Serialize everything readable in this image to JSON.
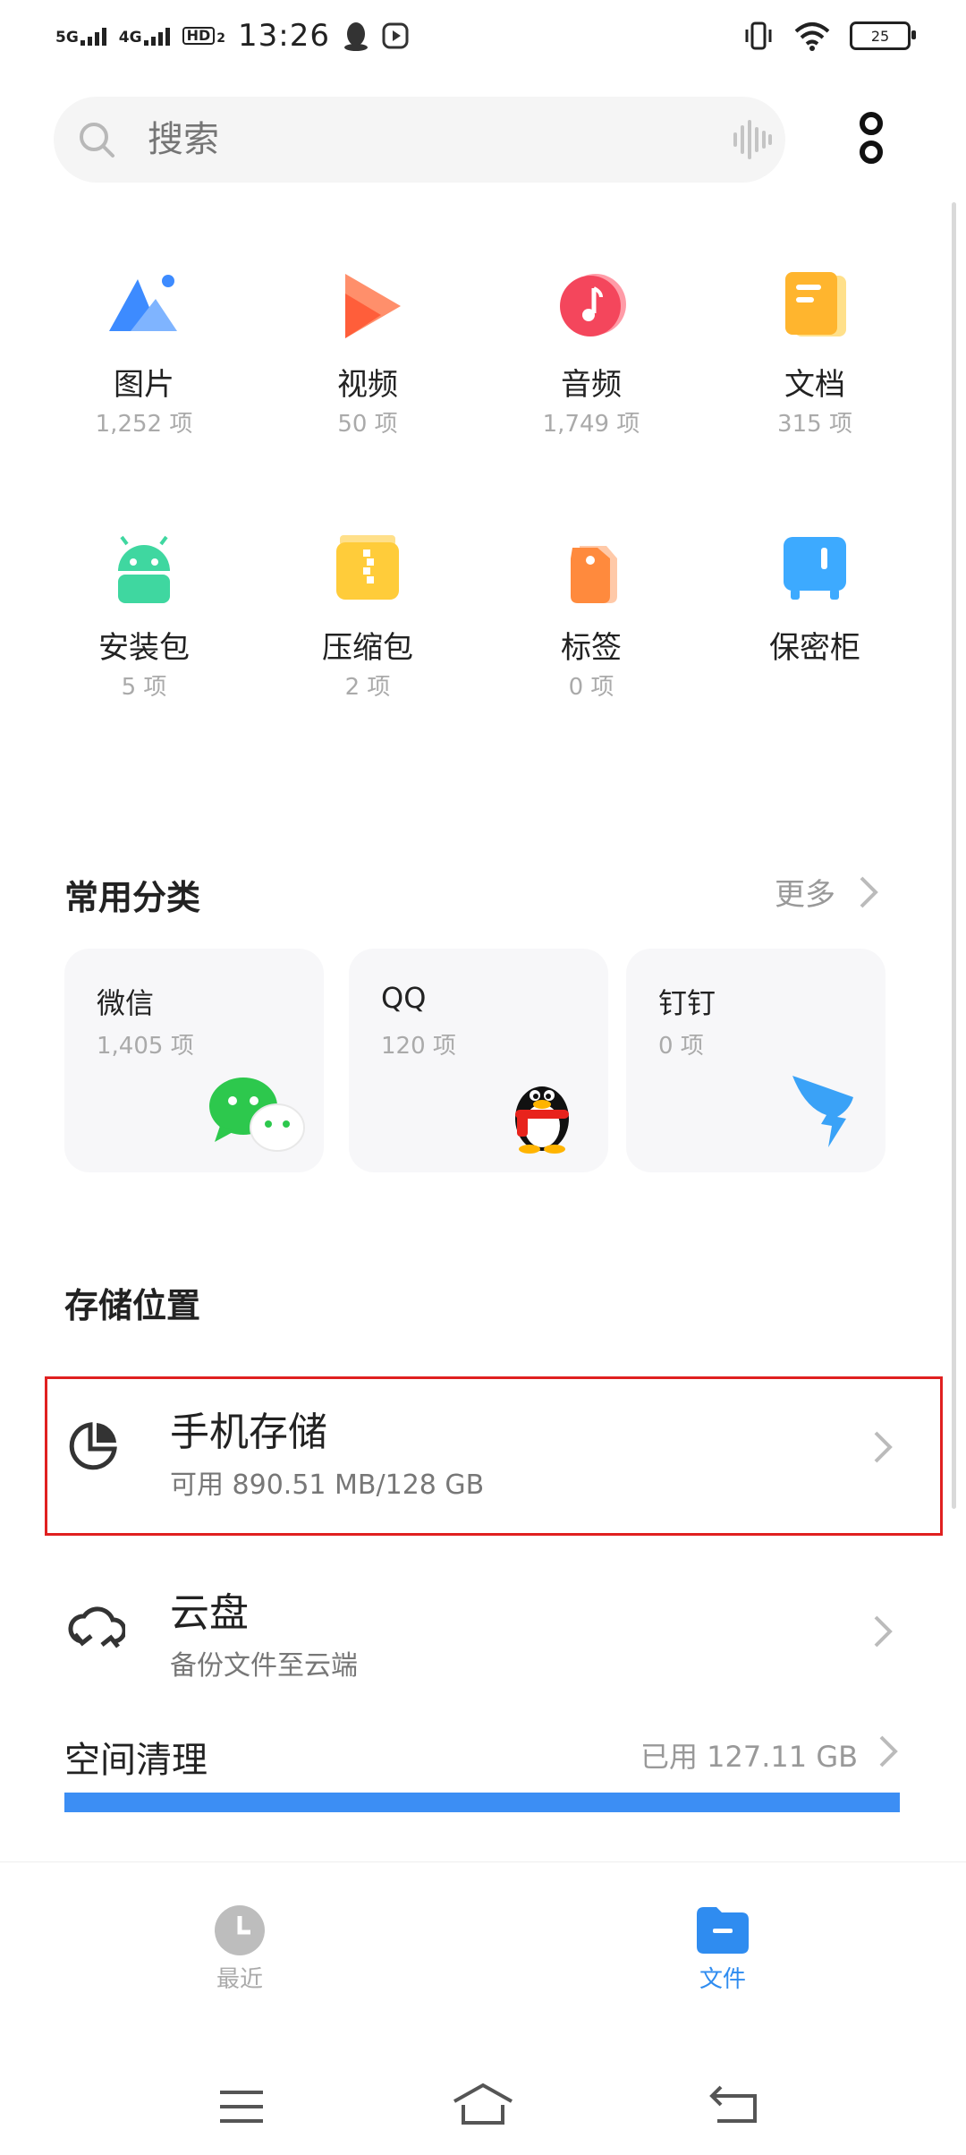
{
  "status_bar": {
    "network1": "5G",
    "network2": "4G",
    "hd": "HD",
    "hd_sub": "2",
    "time": "13:26",
    "battery": "25"
  },
  "search": {
    "placeholder": "搜索"
  },
  "categories": [
    {
      "name": "图片",
      "count": "1,252 项",
      "icon": "image-icon"
    },
    {
      "name": "视频",
      "count": "50 项",
      "icon": "video-icon"
    },
    {
      "name": "音频",
      "count": "1,749 项",
      "icon": "audio-icon"
    },
    {
      "name": "文档",
      "count": "315 项",
      "icon": "document-icon"
    },
    {
      "name": "安装包",
      "count": "5 项",
      "icon": "android-icon"
    },
    {
      "name": "压缩包",
      "count": "2 项",
      "icon": "archive-icon"
    },
    {
      "name": "标签",
      "count": "0 项",
      "icon": "tag-icon"
    },
    {
      "name": "保密柜",
      "count": "",
      "icon": "safe-icon"
    }
  ],
  "common": {
    "title": "常用分类",
    "more": "更多",
    "apps": [
      {
        "name": "微信",
        "count": "1,405 项",
        "icon": "wechat-icon"
      },
      {
        "name": "QQ",
        "count": "120 项",
        "icon": "qq-penguin-icon"
      },
      {
        "name": "钉钉",
        "count": "0 项",
        "icon": "dingtalk-icon"
      }
    ]
  },
  "storage": {
    "title": "存储位置",
    "phone": {
      "title": "手机存储",
      "sub": "可用 890.51 MB/128 GB"
    },
    "cloud": {
      "title": "云盘",
      "sub": "备份文件至云端"
    }
  },
  "cleanup": {
    "title": "空间清理",
    "used": "已用 127.11 GB",
    "progress": 1.0
  },
  "bottom_nav": {
    "recent": "最近",
    "files": "文件"
  },
  "colors": {
    "accent": "#2f8cf0",
    "highlight": "#e02020"
  }
}
